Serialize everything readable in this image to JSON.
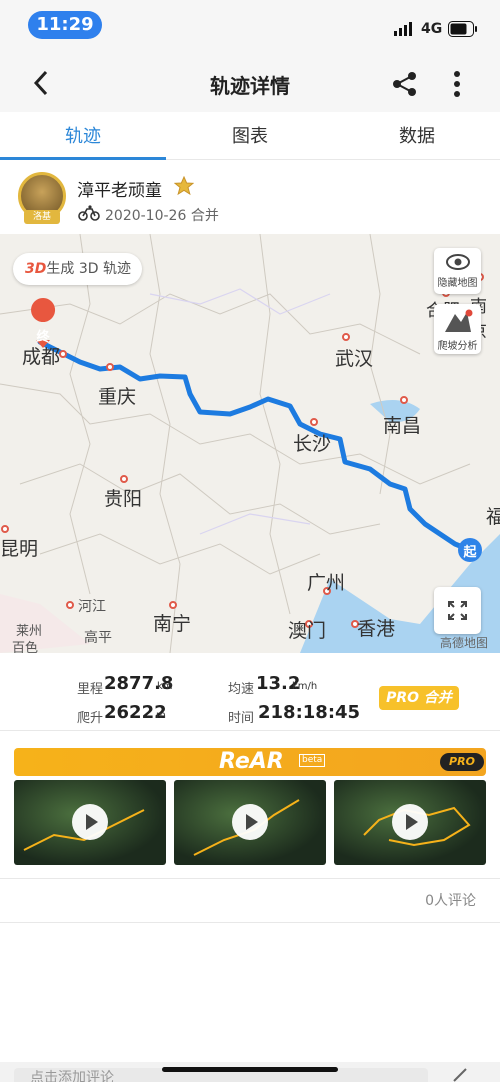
{
  "status": {
    "time": "11:29",
    "network": "4G"
  },
  "nav": {
    "title": "轨迹详情"
  },
  "tabs": [
    {
      "label": "轨迹",
      "active": true
    },
    {
      "label": "图表",
      "active": false
    },
    {
      "label": "数据",
      "active": false
    }
  ],
  "user": {
    "name": "漳平老顽童",
    "avatar_tag": "洛基",
    "date": "2020-10-26",
    "merge_note": "合并"
  },
  "map": {
    "btn_3d_prefix": "3D",
    "btn_3d_label": "生成 3D 轨迹",
    "hide_map_label": "隐藏地图",
    "climb_label": "爬坡分析",
    "end_marker": "终",
    "start_marker": "起",
    "attribution": "高德地图",
    "route_color": "#2d8ae6",
    "cities": [
      "成都",
      "重庆",
      "武汉",
      "长沙",
      "南昌",
      "贵阳",
      "昆明",
      "广州",
      "南宁",
      "澳门",
      "香港",
      "合肥",
      "南京",
      "福",
      "河江",
      "莱州",
      "高平",
      "百色"
    ]
  },
  "stats": {
    "distance": {
      "label": "里程",
      "value": "2877.8",
      "unit": "km"
    },
    "avg_speed": {
      "label": "均速",
      "value": "13.2",
      "unit": "km/h"
    },
    "climb": {
      "label": "爬升",
      "value": "26222",
      "unit": "m"
    },
    "duration": {
      "label": "时间",
      "value": "218:18:45"
    },
    "pro_merge": "PRO 合并"
  },
  "rear": {
    "title": "ReAR",
    "beta": "beta",
    "pro": "PRO"
  },
  "comments": {
    "count_label": "0人评论",
    "input_placeholder": "点击添加评论"
  }
}
